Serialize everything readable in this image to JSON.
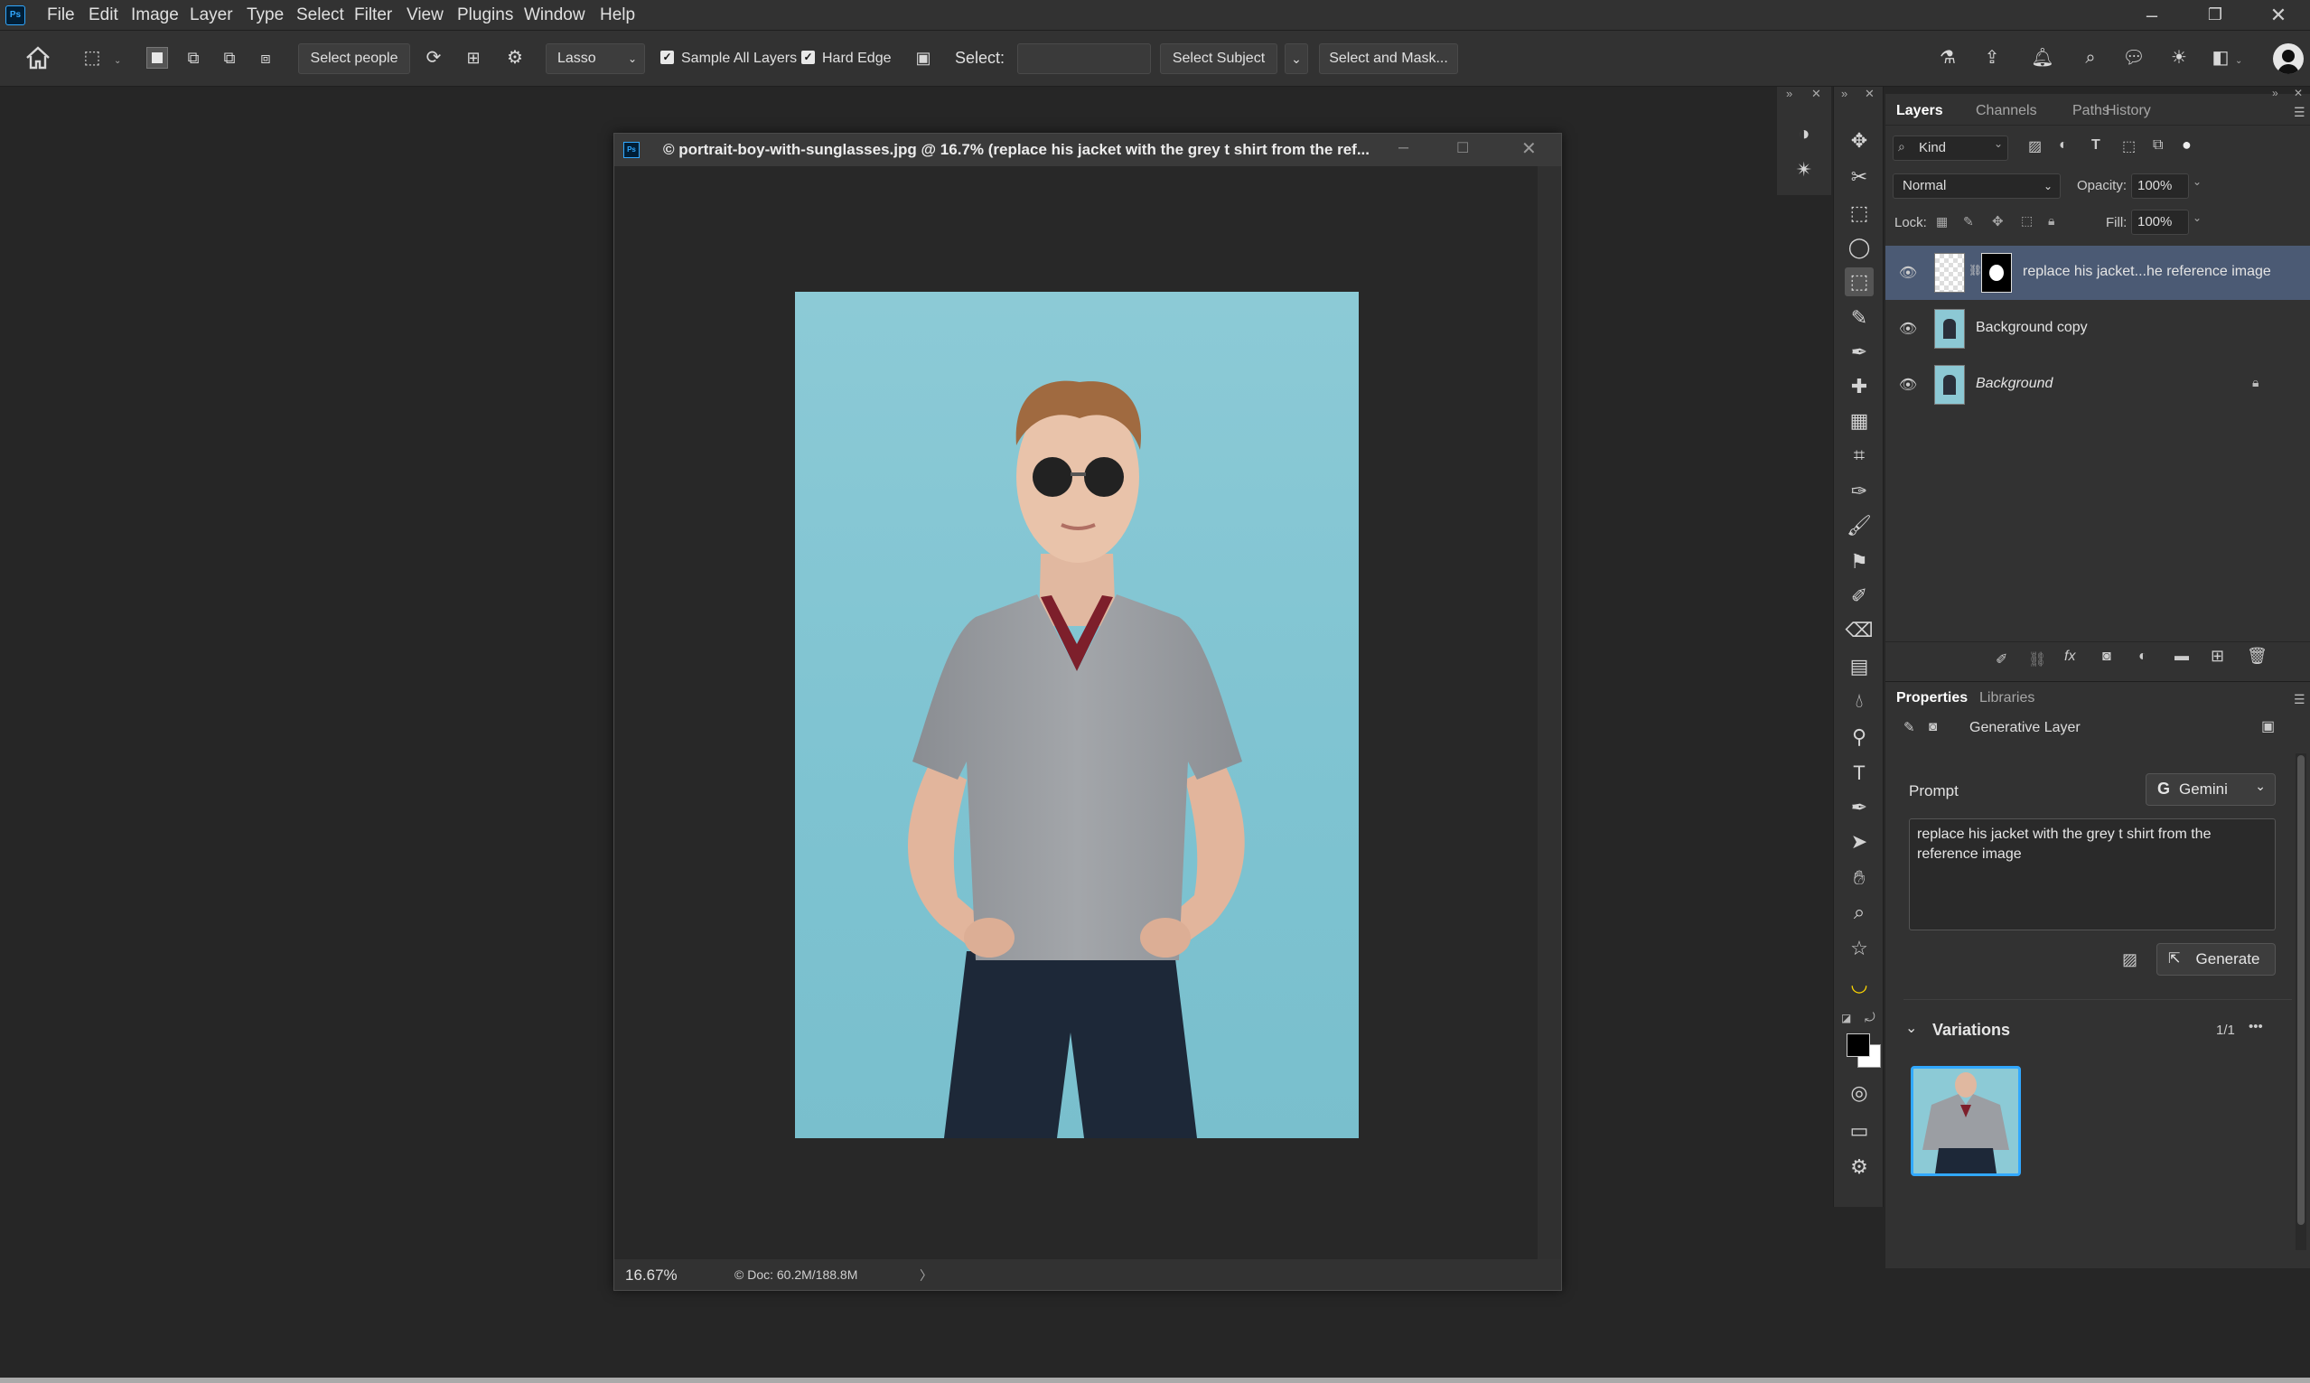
{
  "menubar": {
    "items": [
      "File",
      "Edit",
      "Image",
      "Layer",
      "Type",
      "Select",
      "Filter",
      "View",
      "Plugins",
      "Window",
      "Help"
    ],
    "logo_text": "Ps"
  },
  "window_controls": {
    "minimize": "–",
    "restore": "❐",
    "close": "✕"
  },
  "options_bar": {
    "select_people": "Select people",
    "lasso_dropdown": "Lasso",
    "sample_all_layers": "Sample All Layers",
    "hard_edge": "Hard Edge",
    "select_label": "Select:",
    "select_value": "",
    "select_subject": "Select Subject",
    "select_and_mask": "Select and Mask..."
  },
  "document": {
    "title": "© portrait-boy-with-sunglasses.jpg @ 16.7% (replace his jacket with the grey t shirt from the ref...",
    "zoom": "16.67%",
    "doc_info": "© Doc: 60.2M/188.8M",
    "status_arrow": "〉"
  },
  "layers_panel": {
    "tabs": [
      "Layers",
      "Channels",
      "Paths",
      "History"
    ],
    "active_tab": "Layers",
    "kind_filter": "Kind",
    "blend_mode": "Normal",
    "opacity_label": "Opacity:",
    "opacity_value": "100%",
    "lock_label": "Lock:",
    "fill_label": "Fill:",
    "fill_value": "100%",
    "layers": [
      {
        "name": "replace his jacket...he reference image",
        "selected": true,
        "italic": false,
        "locked": false
      },
      {
        "name": "Background copy",
        "selected": false,
        "italic": false,
        "locked": false
      },
      {
        "name": "Background",
        "selected": false,
        "italic": true,
        "locked": true
      }
    ]
  },
  "properties_panel": {
    "tabs": [
      "Properties",
      "Libraries"
    ],
    "active_tab": "Properties",
    "layer_type": "Generative Layer",
    "prompt_label": "Prompt",
    "model": "Gemini",
    "prompt_text": "replace his jacket with the grey t shirt from the reference image",
    "generate_label": "Generate",
    "variations_label": "Variations",
    "variations_count": "1/1",
    "more": "•••"
  },
  "colors": {
    "ui_bg": "#262626",
    "panel_bg": "#323232",
    "selected_layer": "#4b5a74",
    "photo_bg": "#85c6d3",
    "accent": "#31a8ff"
  }
}
